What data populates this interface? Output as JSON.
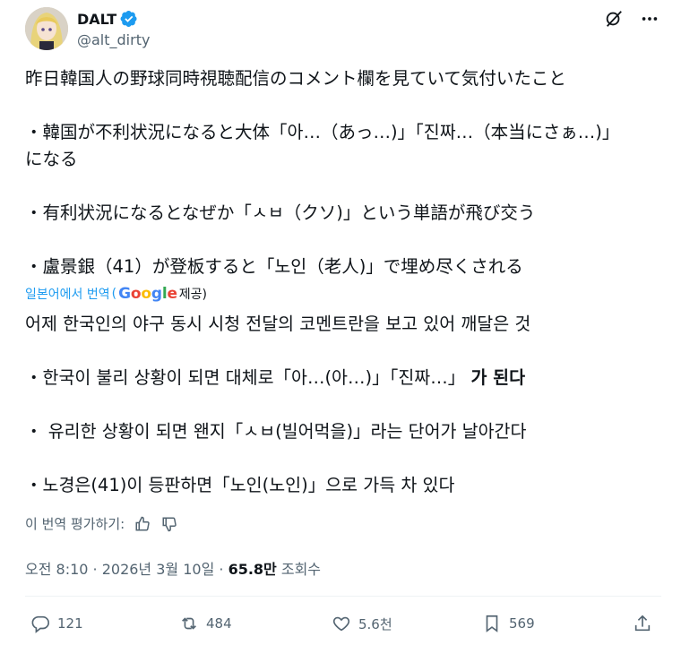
{
  "author": {
    "display_name": "DALT",
    "handle": "@alt_dirty"
  },
  "original_lines": [
    "昨日韓国人の野球同時視聴配信のコメント欄を見ていて気付いたこと",
    "・韓国が不利状況になると大体「아…（あっ…)」「진짜…（本当にさぁ…)」",
    "になる",
    "・有利状況になるとなぜか「ㅅㅂ（クソ)」という単語が飛び交う",
    "・盧景銀（41）が登板すると「노인（老人)」で埋め尽くされる"
  ],
  "translation_label": "일본어에서 번역",
  "translation_paren": "(",
  "google_letters": [
    "G",
    "o",
    "o",
    "g",
    "l",
    "e"
  ],
  "translation_provided": "제공)",
  "translated_lines": [
    "어제 한국인의 야구 동시 시청 전달의 코멘트란을 보고 있어 깨달은 것",
    "・한국이 불리 상황이 되면 대체로「아…(아…)」「진짜…」",
    "가 된다",
    "・ 유리한 상황이 되면 왠지「ㅅㅂ(빌어먹을)」라는 단어가 날아간다",
    "・노경은(41)이 등판하면「노인(노인)」으로 가득 차 있다"
  ],
  "rate_label": "이 번역 평가하기:",
  "meta": {
    "time": "오전 8:10 · 2026년 3월 10일 · ",
    "views_count": "65.8만",
    "views_label": " 조회수"
  },
  "actions": {
    "replies": "121",
    "reposts": "484",
    "likes": "5.6천",
    "bookmarks": "569"
  },
  "colors": {
    "accent": "#1d9bf0",
    "text": "#0f1419",
    "secondary": "#536471"
  }
}
